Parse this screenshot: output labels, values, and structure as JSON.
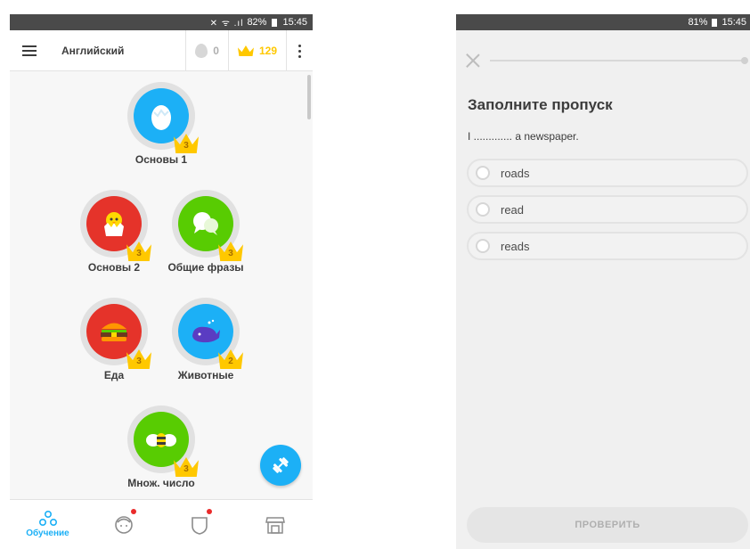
{
  "left": {
    "status": {
      "icons": "✕ ᯤ .ıl",
      "battery": "82%",
      "time": "15:45"
    },
    "appbar": {
      "title": "Английский",
      "streak": "0",
      "crowns": "129"
    },
    "skills": [
      {
        "label": "Основы 1",
        "level": "3",
        "color": "#1cb0f6",
        "icon": "egg-icon"
      },
      {
        "label": "Основы 2",
        "level": "3",
        "color": "#e5332a",
        "icon": "chick-icon"
      },
      {
        "label": "Общие фразы",
        "level": "3",
        "color": "#58cc02",
        "icon": "speech-bubbles-icon"
      },
      {
        "label": "Еда",
        "level": "3",
        "color": "#e5332a",
        "icon": "burger-icon"
      },
      {
        "label": "Животные",
        "level": "2",
        "color": "#1cb0f6",
        "icon": "whale-icon"
      },
      {
        "label": "Множ. число",
        "level": "3",
        "color": "#58cc02",
        "icon": "bees-icon"
      }
    ],
    "nav": {
      "learn": "Обучение"
    }
  },
  "right": {
    "status": {
      "battery": "81%",
      "time": "15:45"
    },
    "question": {
      "title": "Заполните пропуск",
      "sentence": "I ............. a newspaper.",
      "options": [
        "roads",
        "read",
        "reads"
      ]
    },
    "check_label": "ПРОВЕРИТЬ"
  }
}
